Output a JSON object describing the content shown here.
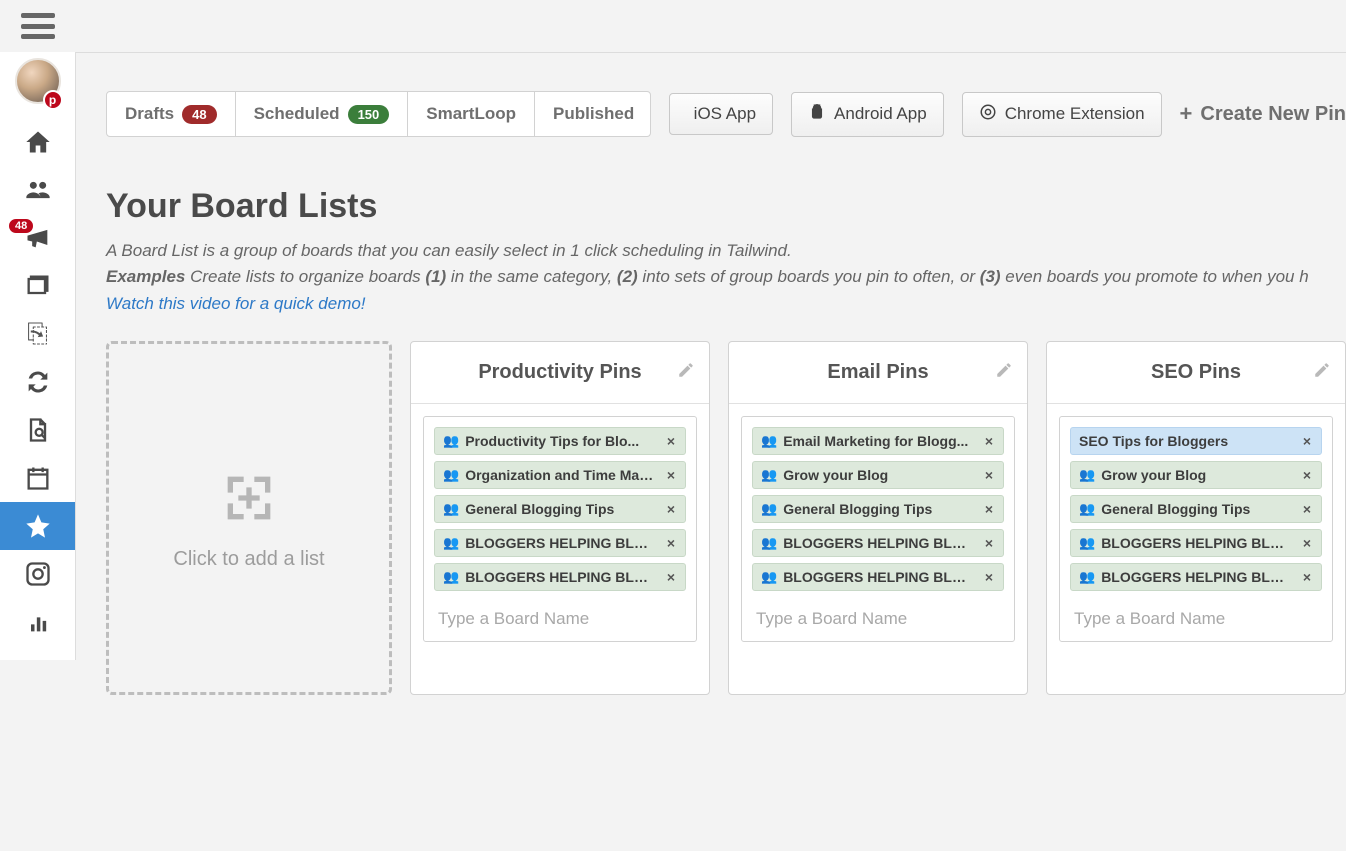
{
  "sidebar": {
    "pinterest_badge": "p",
    "megaphone_badge": "48"
  },
  "tabs": {
    "drafts": {
      "label": "Drafts",
      "count": "48"
    },
    "scheduled": {
      "label": "Scheduled",
      "count": "150"
    },
    "smartloop": {
      "label": "SmartLoop"
    },
    "published": {
      "label": "Published"
    }
  },
  "buttons": {
    "ios": "iOS App",
    "android": "Android App",
    "chrome": "Chrome Extension",
    "create_pin": "Create New Pin"
  },
  "page": {
    "title": "Your Board Lists",
    "desc_line1": "A Board List is a group of boards that you can easily select in 1 click scheduling in Tailwind.",
    "examples_label": "Examples",
    "desc_part_a": " Create lists to organize boards ",
    "num1": "(1)",
    "desc_part_b": " in the same category, ",
    "num2": "(2)",
    "desc_part_c": " into sets of group boards you pin to often, or ",
    "num3": "(3)",
    "desc_part_d": " even boards you promote to when you h",
    "video_link": "Watch this video for a quick demo!"
  },
  "add_list_label": "Click to add a list",
  "boards": [
    {
      "title": "Productivity Pins",
      "tags": [
        {
          "label": "Productivity Tips for Blo...",
          "highlight": false
        },
        {
          "label": "Organization and Time Man...",
          "highlight": false
        },
        {
          "label": "General Blogging Tips",
          "highlight": false
        },
        {
          "label": "BLOGGERS HELPING BLOGGERS...",
          "highlight": false
        },
        {
          "label": "BLOGGERS HELPING BLOGGERS...",
          "highlight": false
        }
      ],
      "placeholder": "Type a Board Name"
    },
    {
      "title": "Email Pins",
      "tags": [
        {
          "label": "Email Marketing for Blogg...",
          "highlight": false
        },
        {
          "label": "Grow your Blog",
          "highlight": false
        },
        {
          "label": "General Blogging Tips",
          "highlight": false
        },
        {
          "label": "BLOGGERS HELPING BLOGGERS...",
          "highlight": false
        },
        {
          "label": "BLOGGERS HELPING BLOGGERS...",
          "highlight": false
        }
      ],
      "placeholder": "Type a Board Name"
    },
    {
      "title": "SEO Pins",
      "tags": [
        {
          "label": "SEO Tips for Bloggers",
          "highlight": true
        },
        {
          "label": "Grow your Blog",
          "highlight": false
        },
        {
          "label": "General Blogging Tips",
          "highlight": false
        },
        {
          "label": "BLOGGERS HELPING BLOGGERS...",
          "highlight": false
        },
        {
          "label": "BLOGGERS HELPING BLOGGERS...",
          "highlight": false
        }
      ],
      "placeholder": "Type a Board Name"
    }
  ]
}
